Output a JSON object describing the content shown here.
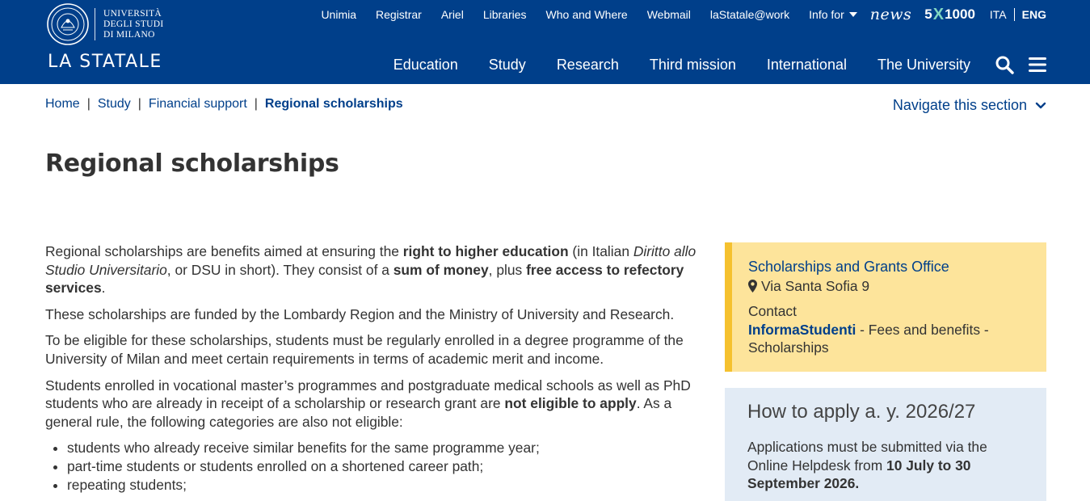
{
  "header": {
    "logo_lines": [
      "UNIVERSITÀ",
      "DEGLI STUDI",
      "DI MILANO"
    ],
    "wordmark": "LA STATALE",
    "top_links": [
      "Unimia",
      "Registrar",
      "Ariel",
      "Libraries",
      "Who and Where",
      "Webmail",
      "laStatale@work"
    ],
    "info_for": "Info for",
    "news": "news",
    "five_x_1000": {
      "left": "5",
      "x": "X",
      "right": "1000"
    },
    "languages": {
      "ita": "ITA",
      "eng": "ENG",
      "active": "ENG"
    },
    "main_nav": [
      "Education",
      "Study",
      "Research",
      "Third mission",
      "International",
      "The University"
    ]
  },
  "breadcrumb": {
    "items": [
      "Home",
      "Study",
      "Financial support"
    ],
    "separator": "|",
    "current": "Regional scholarships"
  },
  "navigate_section": "Navigate this section",
  "page_title": "Regional scholarships",
  "content": {
    "p1": {
      "t1": "Regional scholarships are benefits aimed at ensuring the ",
      "b1": "right to higher education",
      "t2": " (in Italian ",
      "i1": "Diritto allo Studio Universitario",
      "t3": ", or DSU in short). They consist of a ",
      "b2": "sum of money",
      "t4": ", plus ",
      "b3": "free access to refectory services",
      "t5": "."
    },
    "p2": "These scholarships are funded by the Lombardy Region and the Ministry of University and Research.",
    "p3": "To be eligible for these scholarships, students must be regularly enrolled in a degree programme of the University of Milan and meet certain requirements in terms of academic merit and income.",
    "p4": {
      "t1": "Students enrolled in vocational master’s programmes and postgraduate medical schools as well as PhD students who are already in receipt of a scholarship or research grant are ",
      "b1": "not eligible to apply",
      "t2": ". As a general rule, the following categories are also not eligible:"
    },
    "list": [
      "students who already receive similar benefits for the same programme year;",
      "part-time students or students enrolled on a shortened career path;",
      "repeating students;"
    ]
  },
  "sidebar": {
    "office": "Scholarships and Grants Office",
    "address": "Via Santa Sofia 9",
    "contact_label": "Contact",
    "contact_link": "InformaStudenti",
    "contact_rest": " - Fees and benefits - Scholarships",
    "apply_title": "How to apply a. y. 2026/27",
    "apply_t1": "Applications must be submitted via the Online Helpdesk from ",
    "apply_b1": "10 July to 30 September 2026."
  },
  "colors": {
    "header_bg": "#003f8a",
    "link": "#003f8a",
    "card_yellow": "#fde49b",
    "card_yellow_border": "#f5c12f",
    "card_blue": "#e2ebf5"
  }
}
